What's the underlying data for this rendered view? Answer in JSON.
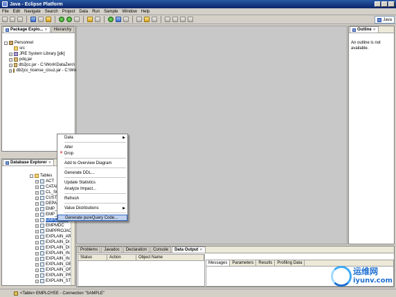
{
  "window": {
    "title": "Java - Eclipse Platform"
  },
  "menubar": {
    "items": [
      "File",
      "Edit",
      "Navigate",
      "Search",
      "Project",
      "Data",
      "Run",
      "Sample",
      "Window",
      "Help"
    ]
  },
  "perspective": {
    "label": "Java"
  },
  "package_explorer": {
    "tabs": [
      "Package Explo...",
      "Hierarchy"
    ],
    "tree": [
      {
        "label": "Personnel",
        "depth": 0,
        "icon": "project-icon",
        "expander": "-"
      },
      {
        "label": "src",
        "depth": 1,
        "icon": "package-folder-icon",
        "expander": ""
      },
      {
        "label": "JRE System Library [jdk]",
        "depth": 1,
        "icon": "library-icon",
        "expander": "+"
      },
      {
        "label": "pdq.jar",
        "depth": 1,
        "icon": "jar-icon",
        "expander": "+"
      },
      {
        "label": "db2jcc.jar - C:\\Work\\DataZero\\",
        "depth": 1,
        "icon": "jar-icon",
        "expander": "+"
      },
      {
        "label": "db2jcc_license_cisuz.jar - C:\\Wo",
        "depth": 1,
        "icon": "jar-icon",
        "expander": "+"
      }
    ]
  },
  "outline": {
    "tab": "Outline",
    "message": "An outline is not available."
  },
  "database_explorer": {
    "tab": "Database Explorer",
    "tables_label": "Tables",
    "tables": [
      "ACT",
      "CATAL",
      "CL_SC",
      "CUSTO",
      "DEPAR",
      "EMP_P",
      "EMP_R",
      "EMPLOYEE",
      "EMPMDC",
      "EMPPROJACT",
      "EXPLAIN_AR",
      "EXPLAIN_DI",
      "EXPLAIN_DI",
      "EXPLAIN_IN",
      "EXPLAIN_IN",
      "EXPLAIN_OB",
      "EXPLAIN_OF",
      "EXPLAIN_PR",
      "EXPLAIN_ST"
    ],
    "selected_table": "EMPLOYEE"
  },
  "context_menu": {
    "items": [
      {
        "label": "Data",
        "submenu": true
      },
      {
        "label": "Alter"
      },
      {
        "label": "Drop",
        "icon": "delete-icon"
      },
      {
        "label": "Add to Overview Diagram"
      },
      {
        "label": "Generate DDL..."
      },
      {
        "label": "Update Statistics"
      },
      {
        "label": "Analyze Impact..."
      },
      {
        "label": "Refresh"
      },
      {
        "label": "Value Distributions",
        "submenu": true
      },
      {
        "label": "Generate pureQuery Code...",
        "highlighted": true
      }
    ]
  },
  "bottom_panel": {
    "tabs": [
      "Problems",
      "Javadoc",
      "Declaration",
      "Console",
      "Data Output"
    ],
    "active_tab": "Data Output",
    "grid_columns": [
      "Status",
      "Action",
      "Object Name"
    ],
    "detail_tabs": [
      "Messages",
      "Parameters",
      "Results",
      "Profiling Data"
    ]
  },
  "statusbar": {
    "text": "<Table> EMPLOYEE - Connection \"SAMPLE\""
  },
  "watermark": {
    "cn": "运维网",
    "en": "iyunv.com"
  }
}
